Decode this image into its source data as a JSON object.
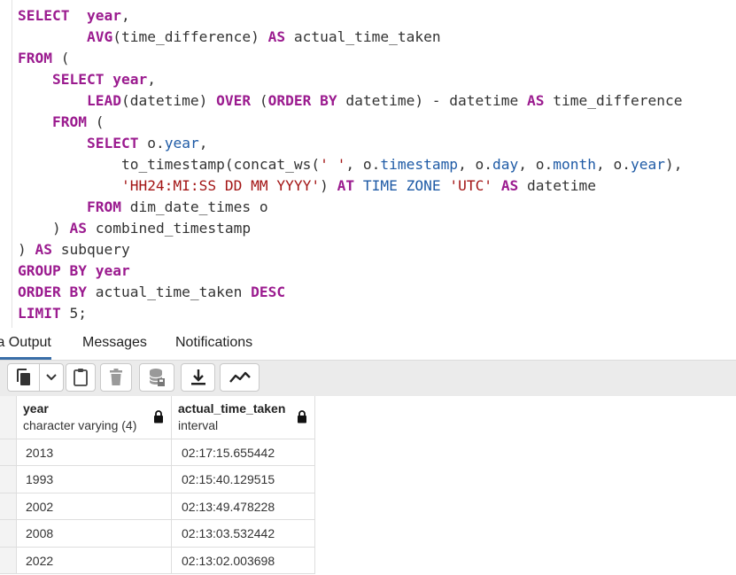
{
  "editor": {
    "lines": [
      [
        {
          "t": "SELECT",
          "c": "kw"
        },
        {
          "t": "  "
        },
        {
          "t": "year",
          "c": "kw"
        },
        {
          "t": ","
        }
      ],
      [
        {
          "t": "        "
        },
        {
          "t": "AVG",
          "c": "kw"
        },
        {
          "t": "(time_difference) "
        },
        {
          "t": "AS",
          "c": "kw"
        },
        {
          "t": " actual_time_taken"
        }
      ],
      [
        {
          "t": "FROM",
          "c": "kw"
        },
        {
          "t": " ("
        }
      ],
      [
        {
          "t": "    "
        },
        {
          "t": "SELECT",
          "c": "kw"
        },
        {
          "t": " "
        },
        {
          "t": "year",
          "c": "kw"
        },
        {
          "t": ","
        }
      ],
      [
        {
          "t": "        "
        },
        {
          "t": "LEAD",
          "c": "kw"
        },
        {
          "t": "(datetime) "
        },
        {
          "t": "OVER",
          "c": "kw"
        },
        {
          "t": " ("
        },
        {
          "t": "ORDER BY",
          "c": "kw"
        },
        {
          "t": " datetime) - datetime "
        },
        {
          "t": "AS",
          "c": "kw"
        },
        {
          "t": " time_difference"
        }
      ],
      [
        {
          "t": "    "
        },
        {
          "t": "FROM",
          "c": "kw"
        },
        {
          "t": " ("
        }
      ],
      [
        {
          "t": "        "
        },
        {
          "t": "SELECT",
          "c": "kw"
        },
        {
          "t": " o."
        },
        {
          "t": "year",
          "c": "prop"
        },
        {
          "t": ","
        }
      ],
      [
        {
          "t": "            to_timestamp(concat_ws("
        },
        {
          "t": "' '",
          "c": "str"
        },
        {
          "t": ", o."
        },
        {
          "t": "timestamp",
          "c": "prop"
        },
        {
          "t": ", o."
        },
        {
          "t": "day",
          "c": "prop"
        },
        {
          "t": ", o."
        },
        {
          "t": "month",
          "c": "prop"
        },
        {
          "t": ", o."
        },
        {
          "t": "year",
          "c": "prop"
        },
        {
          "t": "),"
        }
      ],
      [
        {
          "t": "            "
        },
        {
          "t": "'HH24:MI:SS DD MM YYYY'",
          "c": "str"
        },
        {
          "t": ") "
        },
        {
          "t": "AT",
          "c": "kw"
        },
        {
          "t": " "
        },
        {
          "t": "TIME ZONE",
          "c": "kb"
        },
        {
          "t": " "
        },
        {
          "t": "'UTC'",
          "c": "str"
        },
        {
          "t": " "
        },
        {
          "t": "AS",
          "c": "kw"
        },
        {
          "t": " datetime"
        }
      ],
      [
        {
          "t": "        "
        },
        {
          "t": "FROM",
          "c": "kw"
        },
        {
          "t": " dim_date_times o"
        }
      ],
      [
        {
          "t": "    ) "
        },
        {
          "t": "AS",
          "c": "kw"
        },
        {
          "t": " combined_timestamp"
        }
      ],
      [
        {
          "t": ") "
        },
        {
          "t": "AS",
          "c": "kw"
        },
        {
          "t": " subquery"
        }
      ],
      [
        {
          "t": "GROUP BY",
          "c": "kw"
        },
        {
          "t": " "
        },
        {
          "t": "year",
          "c": "kw"
        }
      ],
      [
        {
          "t": "ORDER BY",
          "c": "kw"
        },
        {
          "t": " actual_time_taken "
        },
        {
          "t": "DESC",
          "c": "kw"
        }
      ],
      [
        {
          "t": "LIMIT",
          "c": "kw"
        },
        {
          "t": " 5;"
        }
      ]
    ]
  },
  "tabs": {
    "data_output": "ta Output",
    "messages": "Messages",
    "notifications": "Notifications"
  },
  "toolbar": {
    "icons": [
      "copy-icon",
      "dropdown-chevron-icon",
      "paste-icon",
      "delete-icon",
      "save-data-icon",
      "download-icon",
      "graph-icon"
    ]
  },
  "grid": {
    "columns": [
      {
        "name": "year",
        "type": "character varying (4)"
      },
      {
        "name": "actual_time_taken",
        "type": "interval"
      }
    ],
    "rows": [
      [
        "2013",
        "02:17:15.655442"
      ],
      [
        "1993",
        "02:15:40.129515"
      ],
      [
        "2002",
        "02:13:49.478228"
      ],
      [
        "2008",
        "02:13:03.532442"
      ],
      [
        "2022",
        "02:13:02.003698"
      ]
    ]
  },
  "colors": {
    "keyword": "#9b1b8f",
    "string": "#a31515",
    "property": "#1f5ba6",
    "active_tab": "#3a6ea8"
  }
}
